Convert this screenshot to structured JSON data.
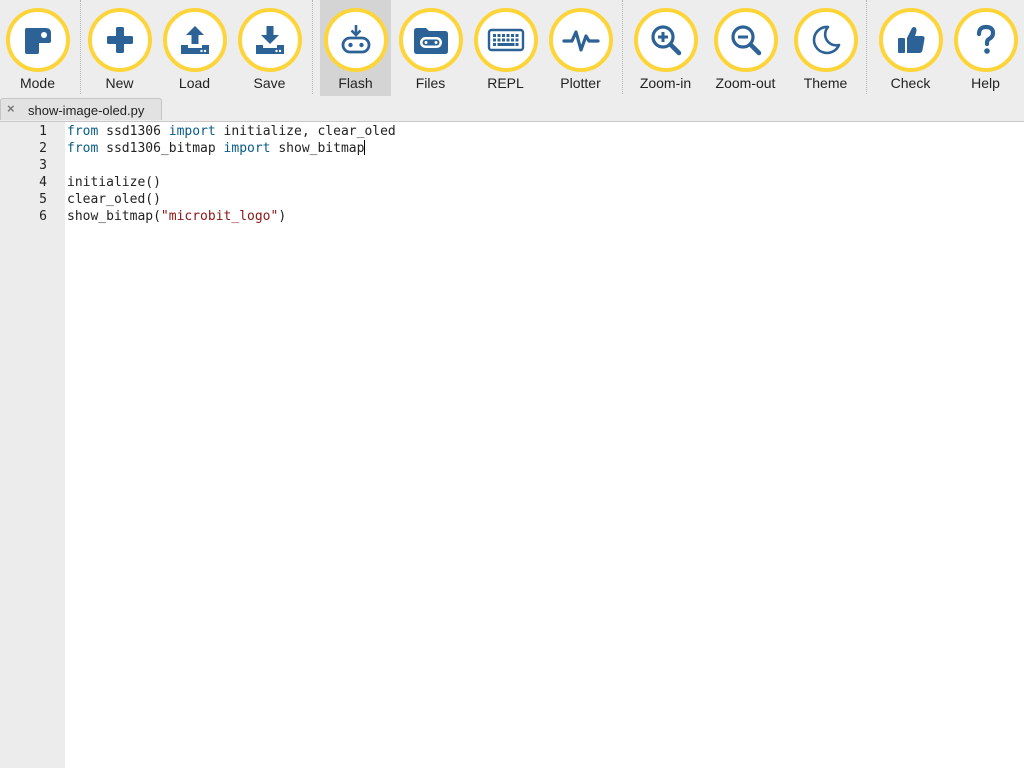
{
  "toolbar": {
    "buttons": [
      {
        "label": "Mode",
        "icon": "mode-icon"
      },
      {
        "label": "New",
        "icon": "plus-icon"
      },
      {
        "label": "Load",
        "icon": "upload-icon"
      },
      {
        "label": "Save",
        "icon": "download-icon"
      },
      {
        "label": "Flash",
        "icon": "flash-icon",
        "active": true
      },
      {
        "label": "Files",
        "icon": "files-icon"
      },
      {
        "label": "REPL",
        "icon": "keyboard-icon"
      },
      {
        "label": "Plotter",
        "icon": "pulse-icon"
      },
      {
        "label": "Zoom-in",
        "icon": "zoom-in-icon"
      },
      {
        "label": "Zoom-out",
        "icon": "zoom-out-icon"
      },
      {
        "label": "Theme",
        "icon": "moon-icon"
      },
      {
        "label": "Check",
        "icon": "thumbs-up-icon"
      },
      {
        "label": "Help",
        "icon": "question-icon"
      }
    ]
  },
  "tab": {
    "title": "show-image-oled.py",
    "close": "×"
  },
  "editor": {
    "line_numbers": [
      "1",
      "2",
      "3",
      "4",
      "5",
      "6"
    ],
    "lines": [
      {
        "kw1": "from",
        "mod": " ssd1306 ",
        "kw2": "import",
        "names": " initialize, clear_oled"
      },
      {
        "kw1": "from",
        "mod": " ssd1306_bitmap ",
        "kw2": "import",
        "names": " show_bitmap"
      },
      {
        "text": ""
      },
      {
        "text": "initialize()"
      },
      {
        "text": "clear_oled()"
      },
      {
        "fn": "show_bitmap(",
        "str": "\"microbit_logo\"",
        "end": ")"
      }
    ]
  },
  "colors": {
    "ring": "#fdd53a",
    "icon": "#2c6295",
    "keyword": "#0a5c86",
    "string": "#8a1414"
  }
}
